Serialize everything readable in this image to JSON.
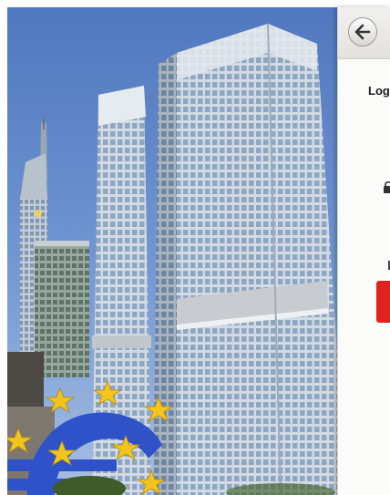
{
  "header": {
    "back_icon": "arrow-left-icon",
    "login_label": "Log"
  },
  "photo": {
    "subject": "ecb-tower-frankfurt",
    "sky_color": "#5d86c9",
    "facade_color": "#c9d3de",
    "euro_sign_color": "#2f52c9",
    "star_color": "#f2c41c"
  },
  "form": {
    "field_icon": "lock-icon",
    "submit_color": "#e1211d"
  }
}
